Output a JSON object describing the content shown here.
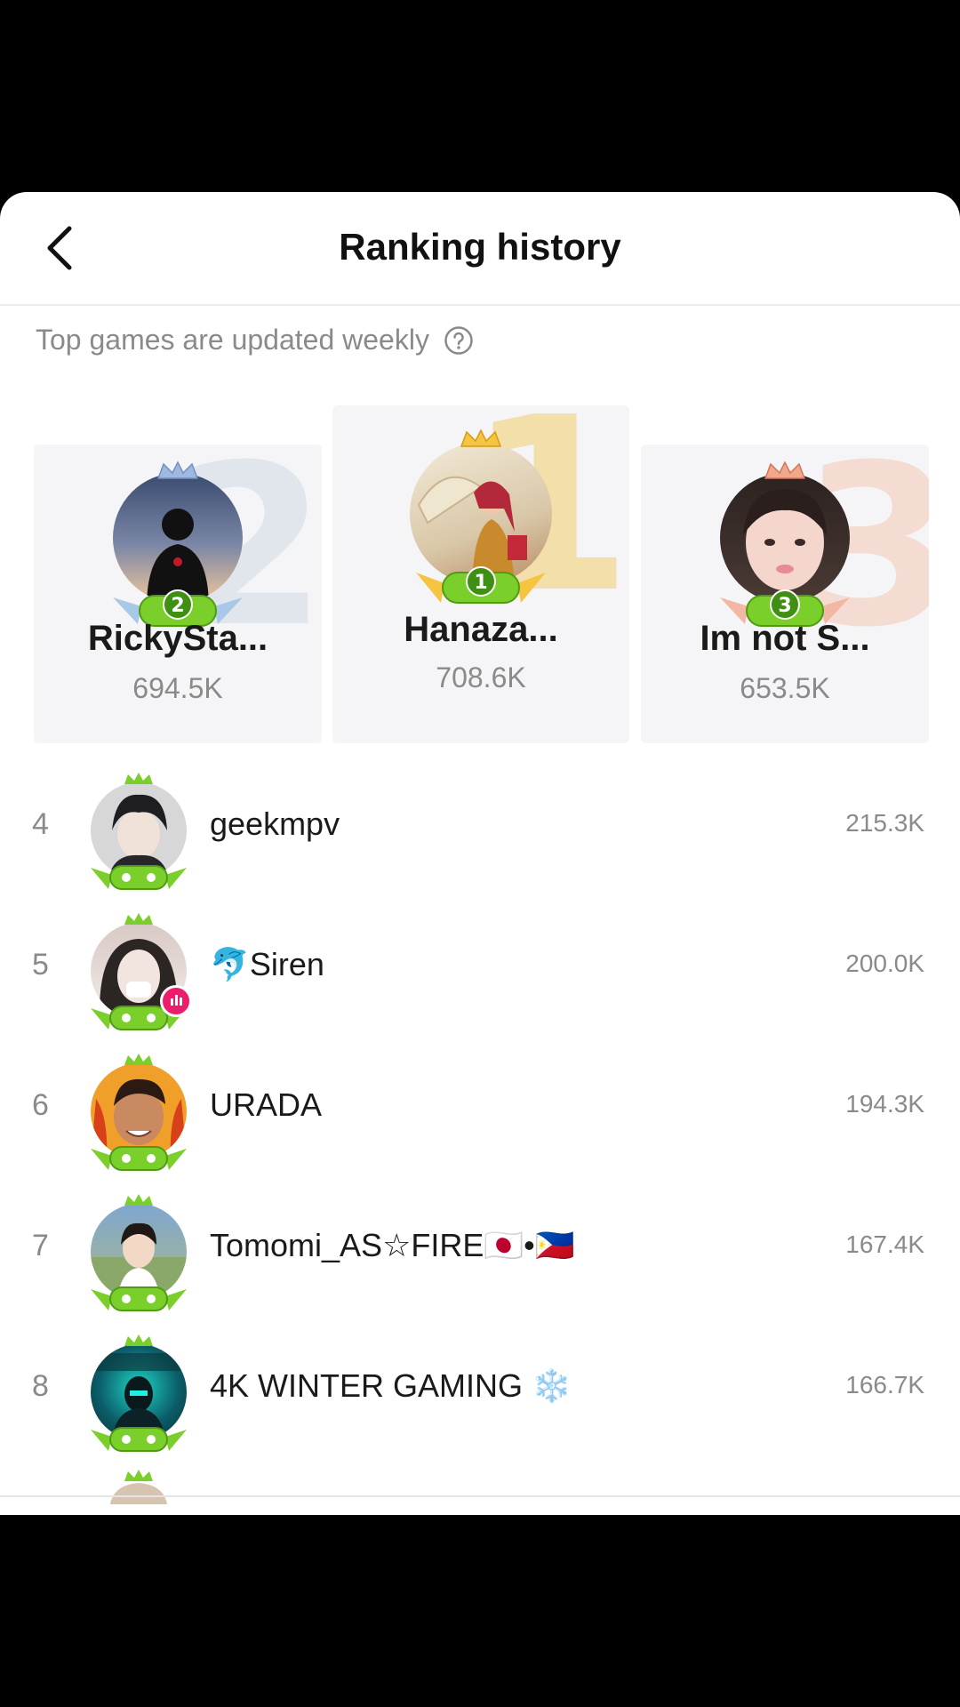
{
  "header": {
    "title": "Ranking history"
  },
  "info": {
    "subtitle": "Top games are updated weekly"
  },
  "podium": [
    {
      "rank": "2",
      "name": "RickySta...",
      "score": "694.5K"
    },
    {
      "rank": "1",
      "name": "Hanaza...",
      "score": "708.6K"
    },
    {
      "rank": "3",
      "name": "Im not S...",
      "score": "653.5K"
    }
  ],
  "list": [
    {
      "rank": "4",
      "name": "geekmpv",
      "score": "215.3K"
    },
    {
      "rank": "5",
      "name": "🐬Siren",
      "score": "200.0K"
    },
    {
      "rank": "6",
      "name": "URADA",
      "score": "194.3K"
    },
    {
      "rank": "7",
      "name": "Tomomi_AS☆FIRE🇯🇵•🇵🇭",
      "score": "167.4K"
    },
    {
      "rank": "8",
      "name": "4K WINTER GAMING ❄️",
      "score": "166.7K"
    }
  ],
  "icons": {
    "back": "chevron-left-icon",
    "help": "question-circle-icon",
    "crown": "crown-icon",
    "medal": "game-controller-medal-icon",
    "live": "live-bars-icon"
  },
  "colors": {
    "gold": "#f3dfaa",
    "silver": "#e1e6ec",
    "bronze": "#f4dcd2",
    "badge_green": "#7bcf2a",
    "live_pink": "#ee1d6b",
    "muted_text": "#8a8a8a"
  }
}
